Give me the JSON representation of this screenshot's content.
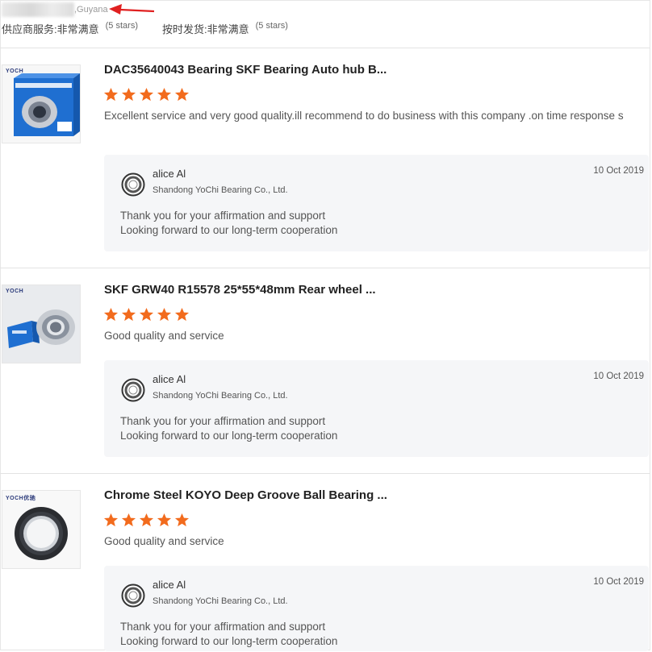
{
  "header": {
    "buyer_country": ",Guyana",
    "service_label": "供应商服务:",
    "service_value": "非常满意",
    "service_stars": "(5 stars)",
    "delivery_label": "按时发货:",
    "delivery_value": "非常满意",
    "delivery_stars": "(5 stars)"
  },
  "colors": {
    "star": "#f26b1d",
    "arrow": "#e02020",
    "reply_bg": "#f5f6f8"
  },
  "reviews": [
    {
      "product_title": "DAC35640043 Bearing SKF Bearing Auto hub B...",
      "rating": 5,
      "comment": "Excellent service and very good quality.ill recommend to do business with this company .on time response s",
      "thumb_brand": "YOCH",
      "thumb_label": "Wheel bearing",
      "seller_name": "alice Al",
      "seller_company": "Shandong YoChi Bearing Co., Ltd.",
      "reply_date": "10 Oct 2019",
      "reply_line1": "Thank you for your affirmation and support",
      "reply_line2": "Looking forward to our long-term cooperation"
    },
    {
      "product_title": "SKF GRW40 R15578 25*55*48mm Rear wheel ...",
      "rating": 5,
      "comment": "Good quality and service",
      "thumb_brand": "YOCH",
      "seller_name": "alice Al",
      "seller_company": "Shandong YoChi Bearing Co., Ltd.",
      "reply_date": "10 Oct 2019",
      "reply_line1": "Thank you for your affirmation and support",
      "reply_line2": "Looking forward to our long-term cooperation"
    },
    {
      "product_title": "Chrome Steel KOYO Deep Groove Ball Bearing ...",
      "rating": 5,
      "comment": "Good quality and service",
      "thumb_brand": "YOCH优驰",
      "seller_name": "alice Al",
      "seller_company": "Shandong YoChi Bearing Co., Ltd.",
      "reply_date": "10 Oct 2019",
      "reply_line1": "Thank you for your affirmation and support",
      "reply_line2": "Looking forward to our long-term cooperation"
    }
  ]
}
